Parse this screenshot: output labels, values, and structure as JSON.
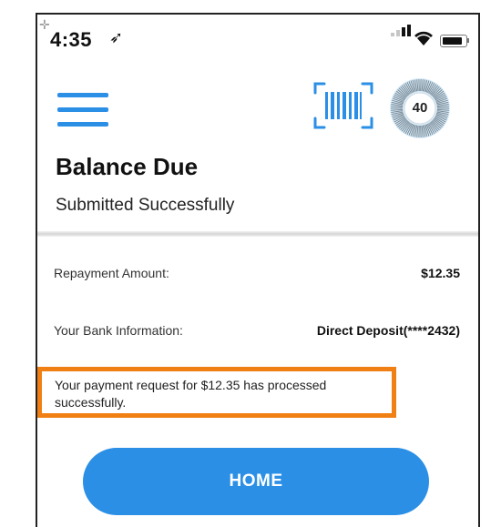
{
  "status_bar": {
    "time": "4:35",
    "location_glyph": "➶"
  },
  "header": {
    "menu_icon": "hamburger-icon",
    "scan_icon": "barcode-scan-icon",
    "timer_value": "40"
  },
  "page": {
    "title": "Balance Due",
    "subtitle": "Submitted Successfully"
  },
  "details": {
    "repayment_label": "Repayment Amount:",
    "repayment_value": "$12.35",
    "bank_label": "Your Bank Information:",
    "bank_value": "Direct Deposit(****2432)"
  },
  "notice": {
    "line1": "Your payment request for $12.35 has processed",
    "line2": "successfully.",
    "highlight_color": "#f07f14"
  },
  "actions": {
    "home_label": "HOME"
  },
  "colors": {
    "accent": "#2b8fe6"
  }
}
